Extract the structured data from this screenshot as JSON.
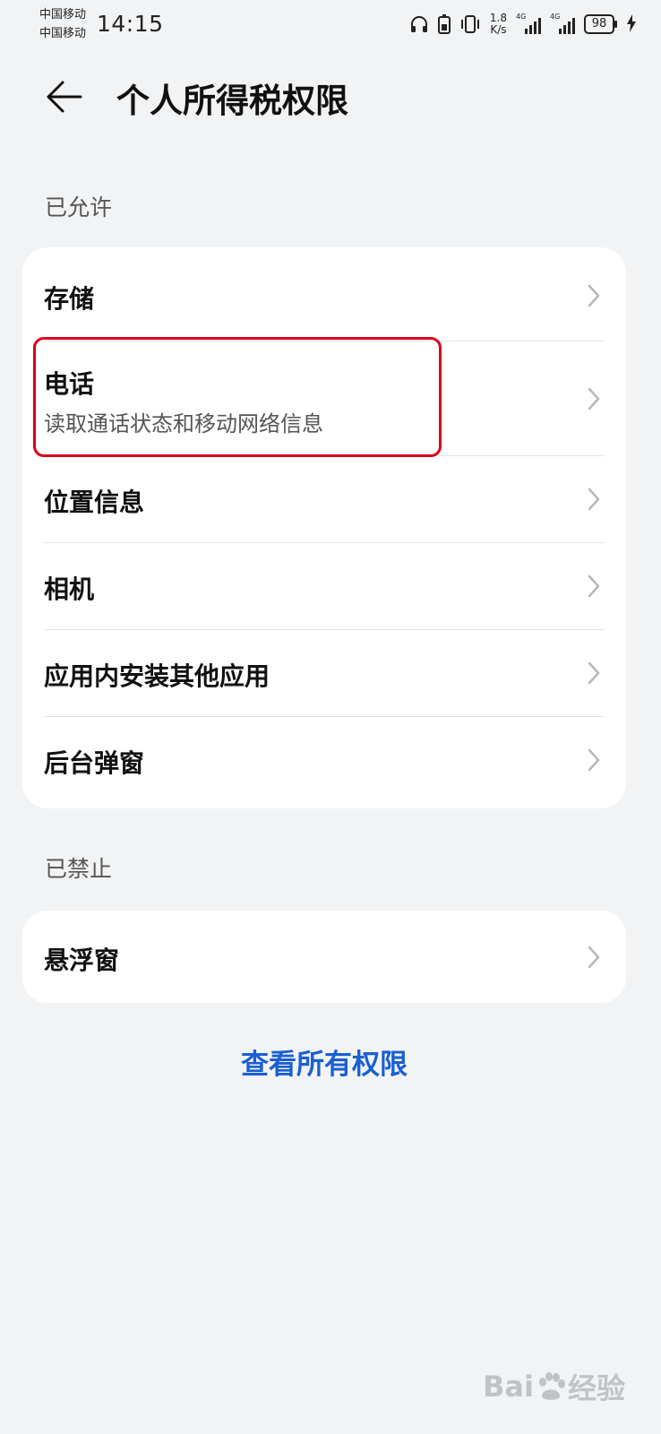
{
  "status_bar": {
    "carrier_1": "中国移动",
    "carrier_2": "中国移动",
    "time": "14:15",
    "net_speed_value": "1.8",
    "net_speed_unit": "K/s",
    "signal_1_label": "4G",
    "signal_2_label": "4G",
    "battery": "98",
    "icons": [
      "headphones-icon",
      "battery-saver-icon",
      "vibrate-icon",
      "signal-icon",
      "charging-icon"
    ]
  },
  "header": {
    "back_icon": "arrow-left-icon",
    "title": "个人所得税权限"
  },
  "allowed": {
    "label": "已允许",
    "items": [
      {
        "label": "存储"
      },
      {
        "label": "电话",
        "subtitle": "读取通话状态和移动网络信息"
      },
      {
        "label": "位置信息"
      },
      {
        "label": "相机"
      },
      {
        "label": "应用内安装其他应用"
      },
      {
        "label": "后台弹窗"
      }
    ]
  },
  "denied": {
    "label": "已禁止",
    "items": [
      {
        "label": "悬浮窗"
      }
    ]
  },
  "view_all": "查看所有权限",
  "watermark": {
    "text_left": "Bai",
    "text_right": "经验"
  },
  "colors": {
    "background": "#f1f3f5",
    "card": "#ffffff",
    "link": "#1a5fd2",
    "highlight": "#d9001b"
  }
}
